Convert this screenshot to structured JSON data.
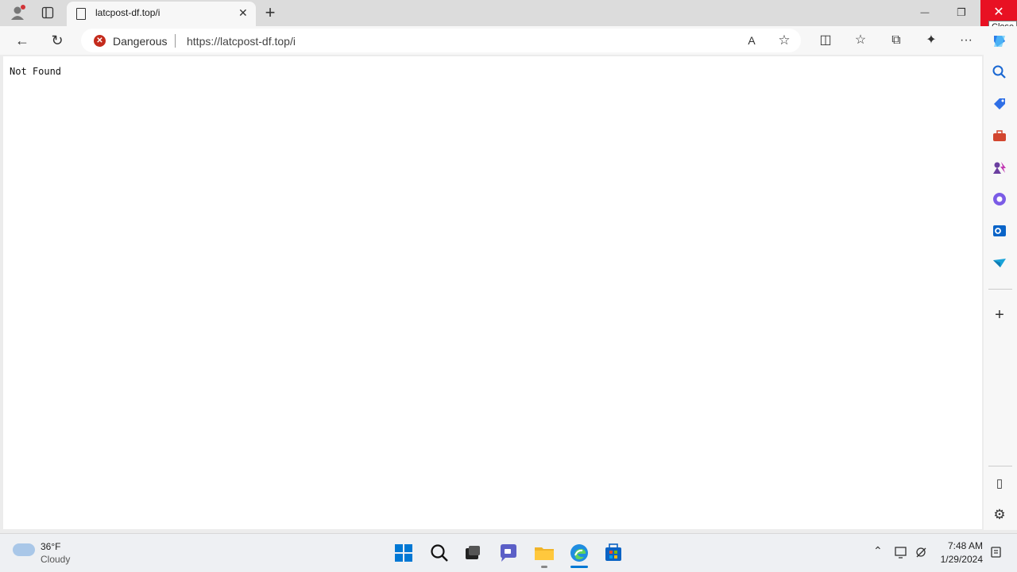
{
  "browser": {
    "tab_title": "latcpost-df.top/i",
    "tab_close_glyph": "✕",
    "new_tab_glyph": "+",
    "minimize_glyph": "—",
    "restore_glyph": "❐",
    "close_glyph": "✕",
    "close_tooltip": "Close"
  },
  "toolbar": {
    "back_glyph": "←",
    "refresh_glyph": "↻",
    "security_label": "Dangerous",
    "security_glyph": "✕",
    "url": "https://latcpost-df.top/i",
    "read_aloud_glyph": "A",
    "favorite_glyph": "☆",
    "split_glyph": "◫",
    "favorites_glyph": "☆",
    "collections_glyph": "⧉",
    "extensions_glyph": "✦",
    "more_glyph": "···"
  },
  "page": {
    "text": "Not Found"
  },
  "siderail": {
    "icons": [
      "copilot-icon",
      "search-icon",
      "shopping-icon",
      "tools-icon",
      "games-icon",
      "microsoft365-icon",
      "outlook-icon",
      "drop-icon"
    ],
    "add_glyph": "+",
    "hide_glyph": "▯",
    "settings_glyph": "⚙"
  },
  "taskbar": {
    "temperature": "36°F",
    "condition": "Cloudy",
    "time": "7:48 AM",
    "date": "1/29/2024",
    "tray_up_glyph": "⌃"
  },
  "colors": {
    "danger": "#c42b1c",
    "close_button": "#e81123",
    "accent": "#0078d4"
  }
}
